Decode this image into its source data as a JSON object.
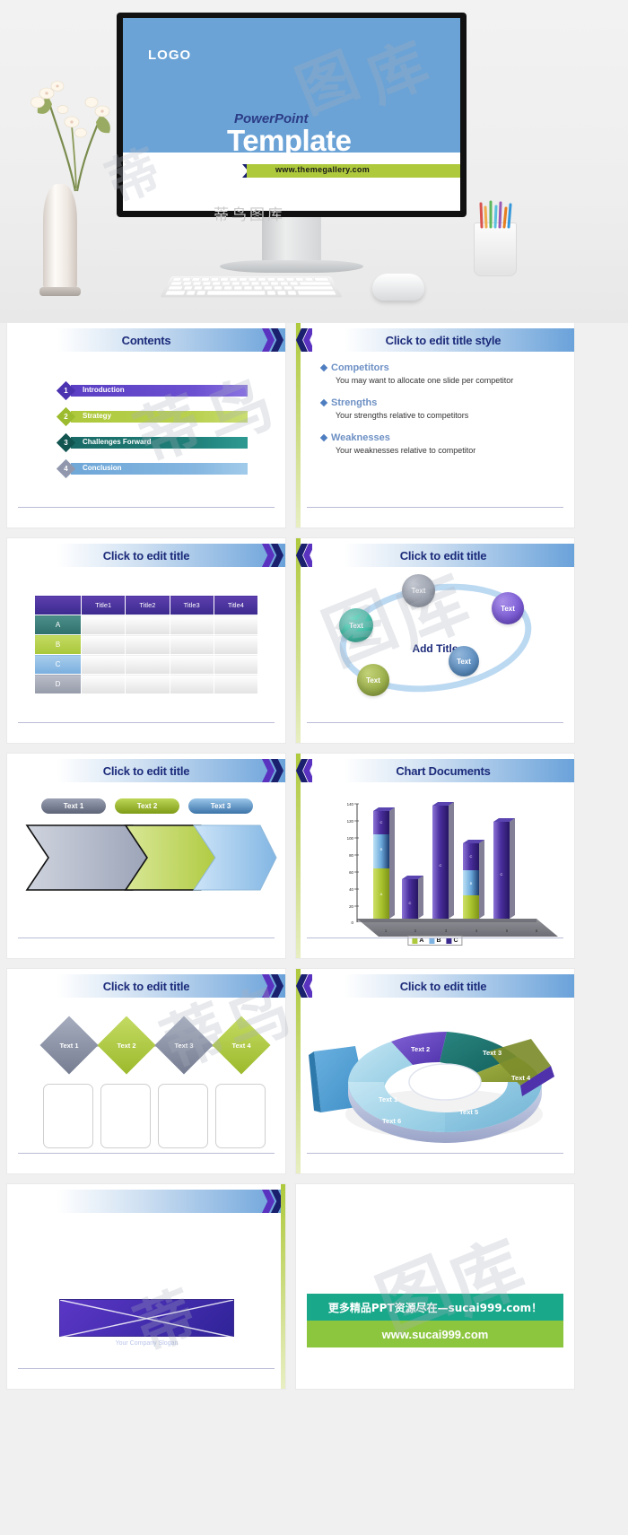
{
  "hero": {
    "watermark_label": "蒂鸟图库",
    "cover": {
      "logo": "LOGO",
      "subtitle": "PowerPoint",
      "title": "Template",
      "url_bar": "www.themegallery.com"
    }
  },
  "watermarks": [
    "蒂",
    "鸟",
    "图",
    "库"
  ],
  "slides": [
    {
      "id": "contents",
      "title": "Contents",
      "items": [
        {
          "num": "1",
          "label": "Introduction",
          "color": "#5b3fc4",
          "dia": "#4b32b0"
        },
        {
          "num": "2",
          "label": "Strategy",
          "color": "#aec93c",
          "dia": "#9cbb2e"
        },
        {
          "num": "3",
          "label": "Challenges Forward",
          "color": "#1a6a66",
          "dia": "#115450"
        },
        {
          "num": "4",
          "label": "Conclusion",
          "color": "#6fa7d8",
          "dia": "#9198ad"
        }
      ]
    },
    {
      "id": "bullets",
      "title": "Click to edit title style",
      "bullets": [
        {
          "head": "Competitors",
          "body": "You may want to allocate one slide per competitor"
        },
        {
          "head": "Strengths",
          "body": "Your strengths relative to competitors"
        },
        {
          "head": "Weaknesses",
          "body": "Your weaknesses relative to competitor"
        }
      ]
    },
    {
      "id": "table",
      "title": "Click to edit title",
      "columns": [
        "",
        "Title1",
        "Title2",
        "Title3",
        "Title4"
      ],
      "rows": [
        {
          "label": "A",
          "color1": "#4c8f8a",
          "color2": "#2f6f6b"
        },
        {
          "label": "B",
          "color1": "#c3da62",
          "color2": "#a9c73a"
        },
        {
          "label": "C",
          "color1": "#a9cdec",
          "color2": "#79aede"
        },
        {
          "label": "D",
          "color1": "#b9bdc9",
          "color2": "#969ba9"
        }
      ]
    },
    {
      "id": "circles",
      "title": "Click to edit title",
      "center_label": "Add Title",
      "bubbles": [
        {
          "label": "Text",
          "color": "#9aa0ad",
          "x": 118,
          "y": 8,
          "size": 37
        },
        {
          "label": "Text",
          "color": "#7b5ad6",
          "x": 218,
          "y": 28,
          "size": 36
        },
        {
          "label": "Text",
          "color": "#43bfa8",
          "x": 48,
          "y": 46,
          "size": 38
        },
        {
          "label": "Text",
          "color": "#5d8fc2",
          "x": 170,
          "y": 88,
          "size": 34
        },
        {
          "label": "Text",
          "color": "#9bb04a",
          "x": 68,
          "y": 108,
          "size": 36
        }
      ]
    },
    {
      "id": "arrows",
      "title": "Click to edit title",
      "pills": [
        {
          "label": "Text 1",
          "c1": "#8d93a6",
          "c2": "#5d6478",
          "x": 38
        },
        {
          "label": "Text 2",
          "c1": "#b8d24b",
          "c2": "#7e9b16",
          "x": 120
        },
        {
          "label": "Text 3",
          "c1": "#8dbce4",
          "c2": "#3c74a8",
          "x": 202
        }
      ],
      "arrows": [
        {
          "c1": "#c7ccd8",
          "c2": "#97a0b4",
          "x": 28
        },
        {
          "c1": "#d3e48e",
          "c2": "#aec93c",
          "x": 118
        },
        {
          "c1": "#bcdcf5",
          "c2": "#7fb4e2",
          "x": 208
        }
      ]
    },
    {
      "id": "chart",
      "title": "Chart Documents"
    },
    {
      "id": "diamonds",
      "title": "Click to edit title",
      "nodes": [
        {
          "label": "Text 1",
          "color": "#8a91a6",
          "x": 46
        },
        {
          "label": "Text 2",
          "color": "#aec93c",
          "x": 110
        },
        {
          "label": "Text 3",
          "color": "#8a91a6",
          "x": 174
        },
        {
          "label": "Text 4",
          "color": "#aec93c",
          "x": 238
        }
      ]
    },
    {
      "id": "donut",
      "title": "Click to edit title",
      "segments": [
        {
          "label": "Text 1",
          "color": "#a8d8ea"
        },
        {
          "label": "Text 2",
          "color": "#6a4bbd"
        },
        {
          "label": "Text 3",
          "color": "#1a6a66"
        },
        {
          "label": "Text 4",
          "color": "#8a9a3a"
        },
        {
          "label": "Text 5",
          "color": "#7fbcd8"
        },
        {
          "label": "Text 6",
          "color": "#a8d8ea"
        }
      ]
    },
    {
      "id": "slogan",
      "title": "",
      "slogan": "Your Company Slogan"
    },
    {
      "id": "promo",
      "teal_line": "更多精品PPT资源尽在—sucai999.com！",
      "green_line": "www.sucai999.com"
    }
  ],
  "chart_data": {
    "type": "bar",
    "title": "Chart Documents",
    "xlabel": "",
    "ylabel": "",
    "categories": [
      "1",
      "2",
      "3",
      "4",
      "5",
      "6"
    ],
    "ylim": [
      0,
      140
    ],
    "yticks": [
      0,
      20,
      40,
      60,
      80,
      100,
      120,
      140
    ],
    "grid": false,
    "legend": [
      "A",
      "B",
      "C"
    ],
    "legend_colors": [
      "#aec93c",
      "#7fb4e2",
      "#3b2a8e"
    ],
    "series": [
      {
        "name": "A",
        "color": "#aec93c",
        "values": [
          48,
          0,
          0,
          30,
          0,
          0
        ]
      },
      {
        "name": "B",
        "color": "#7fb4e2",
        "values": [
          40,
          0,
          0,
          30,
          0,
          0
        ]
      },
      {
        "name": "C",
        "color": "#3b2a8e",
        "values": [
          42,
          47,
          135,
          35,
          115,
          0
        ]
      }
    ],
    "totals": [
      130,
      47,
      135,
      95,
      115,
      0
    ],
    "stacked": true
  }
}
